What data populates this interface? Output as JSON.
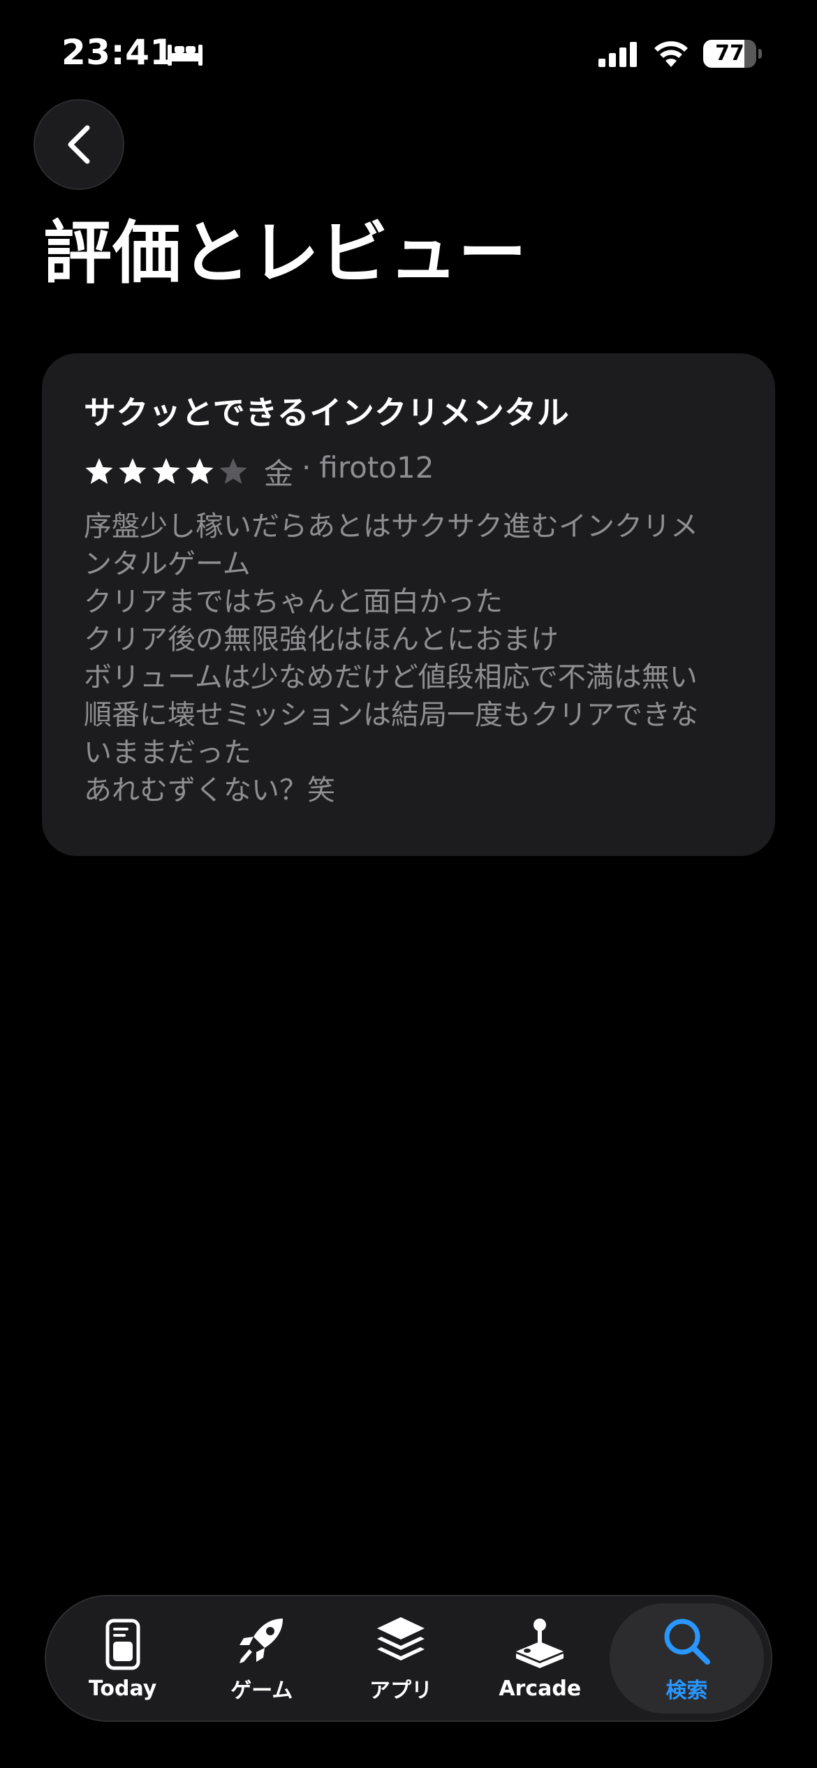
{
  "status_bar": {
    "time": "23:41",
    "battery_percent": "77",
    "battery_level": 0.77
  },
  "page": {
    "title": "評価とレビュー"
  },
  "review": {
    "title": "サクッとできるインクリメンタル",
    "rating": 4,
    "max_rating": 5,
    "date": "金",
    "separator": "·",
    "author": "firoto12",
    "body_lines": [
      "序盤少し稼いだらあとはサクサク進むインクリメ",
      "ンタルゲーム",
      "クリアまではちゃんと面白かった",
      "クリア後の無限強化はほんとにおまけ",
      "ボリュームは少なめだけど値段相応で不満は無い",
      "順番に壊せミッションは結局一度もクリアできな",
      "いままだった",
      "あれむずくない？笑"
    ]
  },
  "tab_bar": {
    "tabs": [
      {
        "label": "Today",
        "icon": "today-icon"
      },
      {
        "label": "ゲーム",
        "icon": "rocket-icon"
      },
      {
        "label": "アプリ",
        "icon": "layers-icon"
      },
      {
        "label": "Arcade",
        "icon": "joystick-icon"
      },
      {
        "label": "検索",
        "icon": "search-icon"
      }
    ],
    "active_index": 4
  },
  "colors": {
    "accent": "#2997ff",
    "card": "#1c1c1e",
    "secondary_text": "#8e8e93",
    "star_filled": "#ffffff",
    "star_empty": "#5a5a5e"
  }
}
